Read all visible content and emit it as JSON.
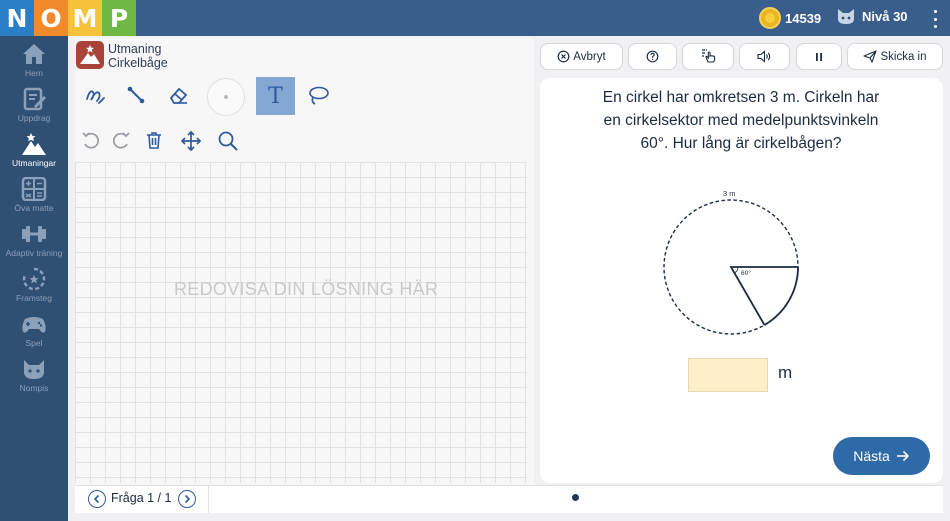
{
  "logo": {
    "letters": [
      "N",
      "O",
      "M",
      "P"
    ],
    "colors": [
      "#2b7fc7",
      "#f08a2a",
      "#f5c23a",
      "#6fb844"
    ]
  },
  "header": {
    "coins": "14539",
    "level": "Nivå 30",
    "coin_icon": "coin-icon",
    "level_icon": "cat-avatar-icon"
  },
  "sidebar": {
    "items": [
      {
        "label": "Hem",
        "icon": "home-icon"
      },
      {
        "label": "Uppdrag",
        "icon": "assignment-icon"
      },
      {
        "label": "Utmaningar",
        "icon": "mountain-icon",
        "active": true
      },
      {
        "label": "Öva matte",
        "icon": "calculator-icon"
      },
      {
        "label": "Adaptiv träning",
        "icon": "dumbbell-icon"
      },
      {
        "label": "Framsteg",
        "icon": "progress-icon"
      },
      {
        "label": "Spel",
        "icon": "gamepad-icon"
      },
      {
        "label": "Nompis",
        "icon": "nompis-icon"
      }
    ]
  },
  "challenge": {
    "line1": "Utmaning",
    "line2": "Cirkelbåge"
  },
  "canvas": {
    "hint": "REDOVISA DIN LÖSNING HÄR",
    "text_tool": "T"
  },
  "actions": {
    "cancel": "Avbryt",
    "submit": "Skicka in"
  },
  "question": {
    "text": "En cirkel har omkretsen 3 m. Cirkeln har en cirkelsektor med medelpunktsvinkeln 60°. Hur lång är cirkelbågen?",
    "figure_circumference_label": "3 m",
    "figure_angle_label": "60°",
    "answer_value": "",
    "unit": "m",
    "next_label": "Nästa"
  },
  "pager": {
    "label": "Fråga 1 / 1"
  }
}
